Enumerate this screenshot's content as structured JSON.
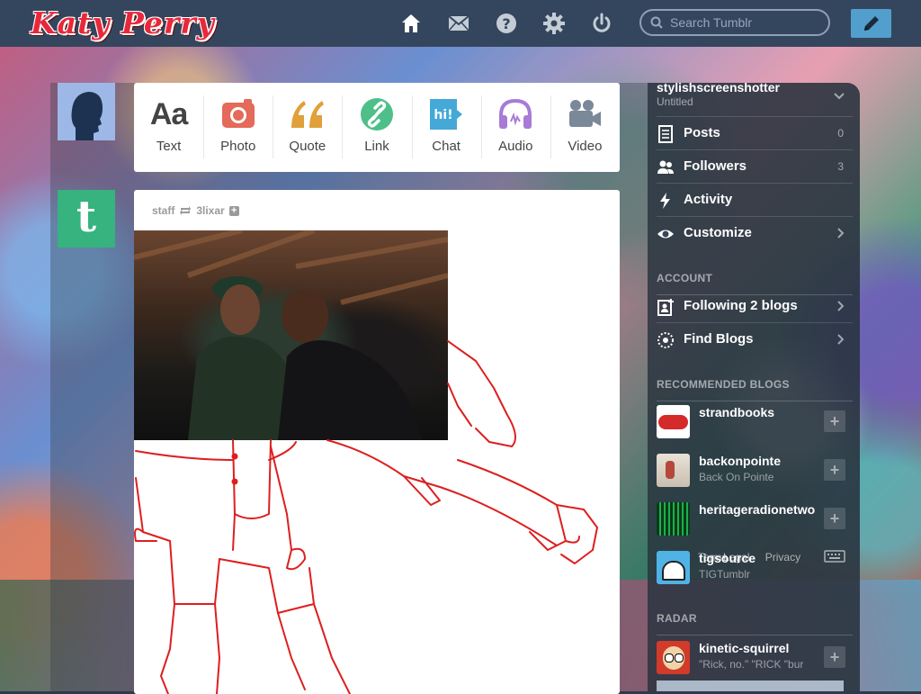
{
  "header": {
    "logo_text": "Katy Perry",
    "search_placeholder": "Search Tumblr",
    "nav": [
      "home-icon",
      "mail-icon",
      "help-icon",
      "gear-icon",
      "power-icon"
    ],
    "compose_icon": "pencil-icon",
    "colors": {
      "bar": "#34465d",
      "compose": "#529ecc"
    }
  },
  "post_types": [
    {
      "label": "Text",
      "icon": "text-icon",
      "color": "#444444"
    },
    {
      "label": "Photo",
      "icon": "camera-icon",
      "color": "#e46a5a"
    },
    {
      "label": "Quote",
      "icon": "quote-icon",
      "color": "#e0a03a"
    },
    {
      "label": "Link",
      "icon": "link-icon",
      "color": "#4fbf8a"
    },
    {
      "label": "Chat",
      "icon": "chat-icon",
      "color": "#45a9d8"
    },
    {
      "label": "Audio",
      "icon": "headphones-icon",
      "color": "#a87bd6"
    },
    {
      "label": "Video",
      "icon": "video-camera-icon",
      "color": "#7a8898"
    }
  ],
  "post": {
    "author": "staff",
    "reblogged_from": "3lixar",
    "reblog_icon": "reblog-icon",
    "follow_icon": "plus-icon"
  },
  "sidebar": {
    "blog_name": "stylishscreenshotter",
    "blog_title": "Untitled",
    "menu": [
      {
        "label": "Posts",
        "count": "0",
        "icon": "posts-icon"
      },
      {
        "label": "Followers",
        "count": "3",
        "icon": "followers-icon"
      },
      {
        "label": "Activity",
        "count": "",
        "icon": "lightning-icon"
      },
      {
        "label": "Customize",
        "count": "",
        "icon": "eye-icon"
      }
    ],
    "account_heading": "ACCOUNT",
    "account_menu": [
      {
        "label": "Following 2 blogs",
        "icon": "following-icon"
      },
      {
        "label": "Find Blogs",
        "icon": "compass-icon"
      }
    ],
    "recommended_heading": "RECOMMENDED BLOGS",
    "recommended": [
      {
        "name": "strandbooks",
        "subtitle": "",
        "avatar": "strand-avatar"
      },
      {
        "name": "backonpointe",
        "subtitle": "Back On Pointe",
        "avatar": "ballet-avatar"
      },
      {
        "name": "heritageradionetwo",
        "subtitle": "",
        "avatar": "radio-avatar"
      },
      {
        "name": "tigsource",
        "subtitle": "TIGTumblr",
        "avatar": "tig-avatar"
      }
    ],
    "overlay_links": {
      "a": "Terms",
      "b": "Legal",
      "c": "Privacy"
    },
    "radar_heading": "RADAR",
    "radar": {
      "name": "kinetic-squirrel",
      "subtitle": "\"Rick, no.\" \"RICK \"bur"
    }
  }
}
